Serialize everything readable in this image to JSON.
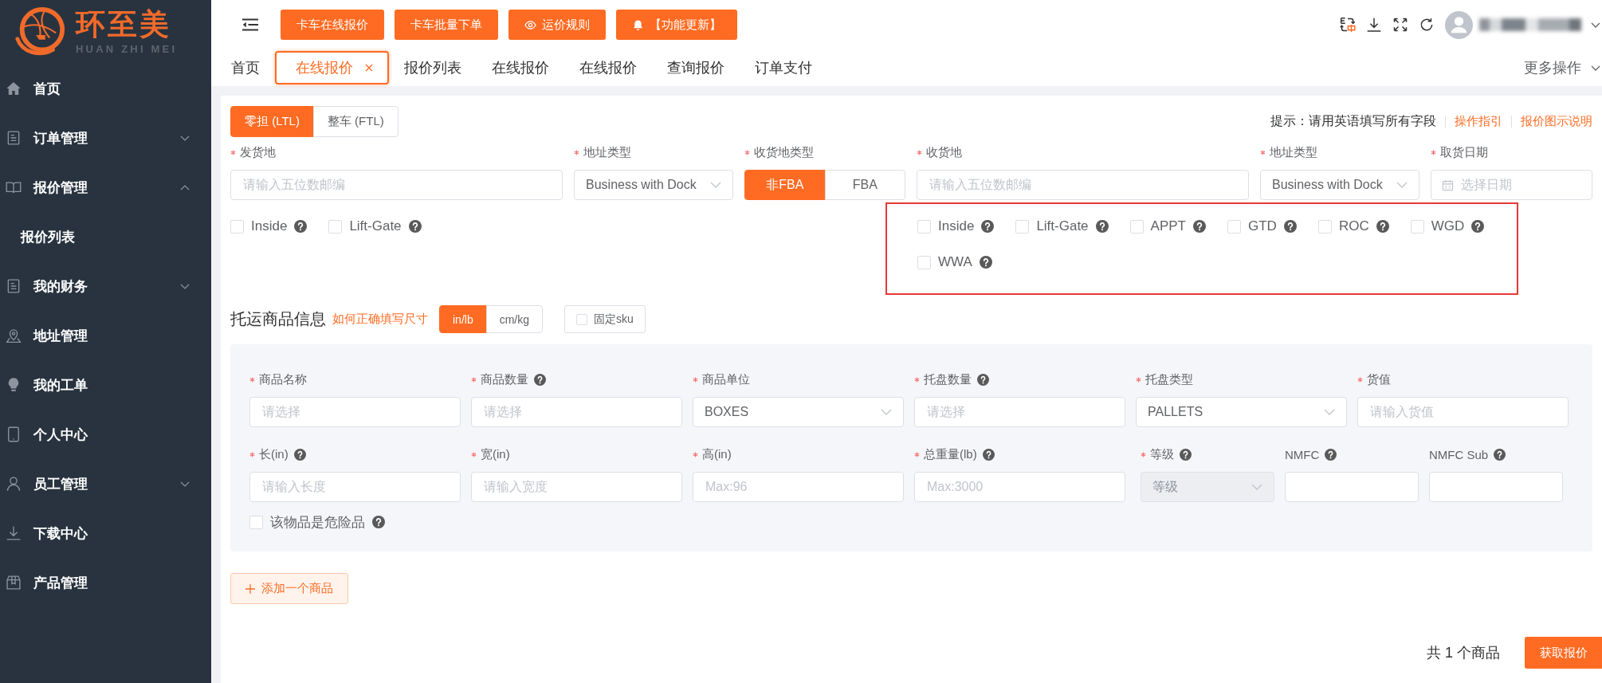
{
  "logo": {
    "title": "环至美",
    "subtitle": "HUAN ZHI MEI"
  },
  "sidebar": {
    "items": [
      {
        "label": "首页"
      },
      {
        "label": "订单管理",
        "expanded": false
      },
      {
        "label": "报价管理",
        "expanded": true,
        "children": [
          {
            "label": "报价列表"
          }
        ]
      },
      {
        "label": "我的财务",
        "expanded": false
      },
      {
        "label": "地址管理"
      },
      {
        "label": "我的工单"
      },
      {
        "label": "个人中心"
      },
      {
        "label": "员工管理",
        "expanded": false
      },
      {
        "label": "下载中心"
      },
      {
        "label": "产品管理"
      }
    ]
  },
  "header": {
    "buttons": [
      {
        "label": "卡车在线报价"
      },
      {
        "label": "卡车批量下单"
      },
      {
        "label": "运价规则"
      },
      {
        "label": "【功能更新】"
      }
    ]
  },
  "tabs": [
    {
      "label": "首页",
      "selected": false,
      "closable": false
    },
    {
      "label": "在线报价",
      "selected": true,
      "closable": true
    },
    {
      "label": "报价列表",
      "selected": false,
      "closable": false
    },
    {
      "label": "在线报价",
      "selected": false,
      "closable": false
    },
    {
      "label": "在线报价",
      "selected": false,
      "closable": false
    },
    {
      "label": "查询报价",
      "selected": false,
      "closable": false
    },
    {
      "label": "订单支付",
      "selected": false,
      "closable": false
    }
  ],
  "more_actions": "更多操作",
  "quote_form": {
    "modes": [
      {
        "label": "零担 (LTL)",
        "selected": true
      },
      {
        "label": "整车 (FTL)",
        "selected": false
      }
    ],
    "hint": "提示：请用英语填写所有字段",
    "help_links": [
      "操作指引",
      "报价图示说明"
    ],
    "fields": [
      {
        "kind": "input",
        "label": "发货地",
        "required": true,
        "placeholder": "请输入五位数邮编"
      },
      {
        "kind": "select",
        "label": "地址类型",
        "required": true,
        "value": "Business with Dock"
      },
      {
        "kind": "segmented",
        "label": "收货地类型",
        "required": true,
        "options": [
          {
            "label": "非FBA",
            "selected": true
          },
          {
            "label": "FBA",
            "selected": false
          }
        ]
      },
      {
        "kind": "input",
        "label": "收货地",
        "required": true,
        "placeholder": "请输入五位数邮编"
      },
      {
        "kind": "select",
        "label": "地址类型",
        "required": true,
        "value": "Business with Dock"
      },
      {
        "kind": "date",
        "label": "取货日期",
        "required": true,
        "placeholder": "选择日期"
      }
    ],
    "origin_services": {
      "options": [
        {
          "label": "Inside",
          "checked": false,
          "help": true
        },
        {
          "label": "Lift-Gate",
          "checked": false,
          "help": true
        }
      ]
    },
    "destination_services": {
      "highlighted": true,
      "options": [
        {
          "label": "Inside",
          "checked": false,
          "help": true
        },
        {
          "label": "Lift-Gate",
          "checked": false,
          "help": true
        },
        {
          "label": "APPT",
          "checked": false,
          "help": true
        },
        {
          "label": "GTD",
          "checked": false,
          "help": true
        },
        {
          "label": "ROC",
          "checked": false,
          "help": true
        },
        {
          "label": "WGD",
          "checked": false,
          "help": true
        },
        {
          "label": "WWA",
          "checked": false,
          "help": true
        }
      ]
    }
  },
  "goods": {
    "title": "托运商品信息",
    "size_guide_link": "如何正确填写尺寸",
    "units": [
      {
        "label": "in/lb",
        "selected": true
      },
      {
        "label": "cm/kg",
        "selected": false
      }
    ],
    "fixed_sku": {
      "label": "固定sku",
      "checked": false
    },
    "items": [
      {
        "rows": [
          [
            {
              "kind": "input",
              "label": "商品名称",
              "required": true,
              "placeholder": "请选择"
            },
            {
              "kind": "input",
              "label": "商品数量",
              "required": true,
              "help": true,
              "placeholder": "请选择"
            },
            {
              "kind": "select",
              "label": "商品单位",
              "required": true,
              "value": "BOXES"
            },
            {
              "kind": "input",
              "label": "托盘数量",
              "required": true,
              "help": true,
              "placeholder": "请选择"
            },
            {
              "kind": "select",
              "label": "托盘类型",
              "required": true,
              "value": "PALLETS"
            },
            {
              "kind": "input",
              "label": "货值",
              "required": true,
              "placeholder": "请输入货值"
            }
          ],
          [
            {
              "kind": "input",
              "label": "长(in)",
              "required": true,
              "help": true,
              "placeholder": "请输入长度"
            },
            {
              "kind": "input",
              "label": "宽(in)",
              "required": true,
              "placeholder": "请输入宽度"
            },
            {
              "kind": "input",
              "label": "高(in)",
              "required": true,
              "placeholder": "Max:96"
            },
            {
              "kind": "input",
              "label": "总重量(lb)",
              "required": true,
              "help": true,
              "placeholder": "Max:3000"
            },
            {
              "kind": "select",
              "label": "等级",
              "required": true,
              "help": true,
              "placeholder": "等级",
              "disabled": true
            },
            {
              "kind": "input",
              "label": "NMFC",
              "help": true
            },
            {
              "kind": "input",
              "label": "NMFC Sub",
              "help": true
            }
          ]
        ],
        "hazardous": {
          "label": "该物品是危险品",
          "checked": false,
          "help": true
        }
      }
    ],
    "add_button": "添加一个商品"
  },
  "footer": {
    "summary": "共 1 个商品",
    "submit_button": "获取报价"
  }
}
